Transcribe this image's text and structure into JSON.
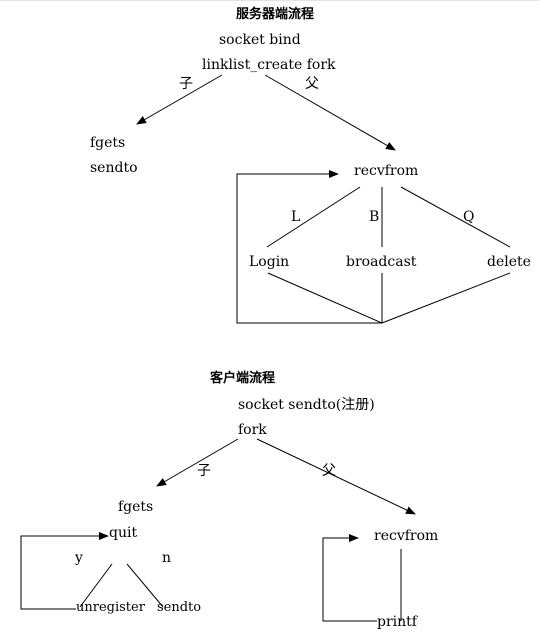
{
  "server": {
    "title": "服务器端流程",
    "step1": "socket bind",
    "step2": "linklist_create fork",
    "child_label": "子",
    "parent_label": "父",
    "child_line1": "fgets",
    "child_line2": "sendto",
    "recv": "recvfrom",
    "branch_l": "L",
    "branch_b": "B",
    "branch_q": "Q",
    "login": "Login",
    "broadcast": "broadcast",
    "delete": "delete"
  },
  "client": {
    "title": "客户端流程",
    "step1": "socket sendto(注册)",
    "step2": "fork",
    "child_label": "子",
    "parent_label": "父",
    "fgets": "fgets",
    "quit": "quit",
    "yes": "y",
    "no": "n",
    "unregister": "unregister",
    "sendto": "sendto",
    "recv": "recvfrom",
    "printf": "printf"
  }
}
